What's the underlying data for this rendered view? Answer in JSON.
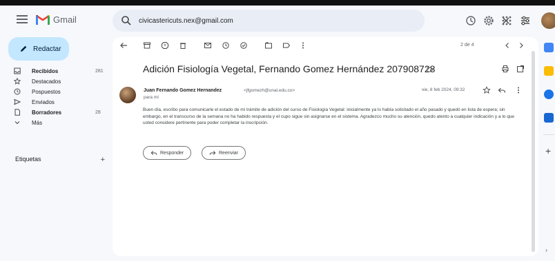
{
  "app": {
    "name": "Gmail",
    "brand_colors": {
      "red": "#ea4335",
      "blue": "#4285f4",
      "green": "#34a853",
      "yellow": "#fbbc04"
    }
  },
  "search": {
    "value": "civicastericuts.nex@gmail.com",
    "icon": "search-icon"
  },
  "sidebar": {
    "compose_label": "Redactar",
    "items": [
      {
        "label": "Recibidos",
        "count": "281",
        "icon": "inbox-icon",
        "bold": true
      },
      {
        "label": "Destacados",
        "count": "",
        "icon": "star-icon",
        "bold": false
      },
      {
        "label": "Pospuestos",
        "count": "",
        "icon": "clock-icon",
        "bold": false
      },
      {
        "label": "Enviados",
        "count": "",
        "icon": "send-icon",
        "bold": false
      },
      {
        "label": "Borradores",
        "count": "28",
        "icon": "draft-icon",
        "bold": true
      },
      {
        "label": "Más",
        "count": "",
        "icon": "chevron-down-icon",
        "bold": false
      }
    ],
    "labels_header": "Etiquetas"
  },
  "toolbar": {
    "pager": "2 de 4"
  },
  "email": {
    "subject": "Adición Fisiología Vegetal, Fernando Gomez Hernández 2079087​28",
    "sender_name": "Juan Fernando Gomez Hernandez",
    "sender_email": "<jfgomezh@unal.edu.co>",
    "recipient": "para mí",
    "date": "vie, 8 feb 2024, 09:32",
    "body": "Buen día, escribo para comunicarle el estado de mi trámite de adición del curso de Fisiología Vegetal: inicialmente ya lo había solicitado el año pasado y quedó en lista de espera; sin embargo, en el transcurso de la semana no ha habido respuesta y el cupo sigue sin asignarse en el sistema. Agradezco mucho su atención, quedo atento a cualquier indicación y a lo que usted considere pertinente para poder completar la inscripción.",
    "reply_label": "Responder",
    "forward_label": "Reenviar"
  }
}
